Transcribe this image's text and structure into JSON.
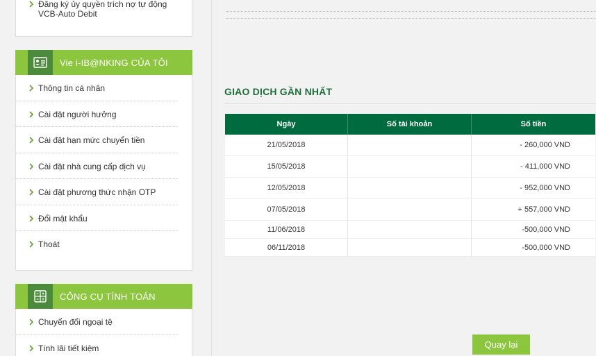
{
  "sidebar": {
    "top_item": {
      "label": "Đăng ký ủy quyền trích nợ tự động VCB-Auto Debit"
    },
    "mine": {
      "title": "Vie i-IB@NKING CỦA TÔI",
      "icon": "user-card-icon",
      "items": [
        {
          "label": "Thông tin cá nhân"
        },
        {
          "label": "Cài đặt người hưởng"
        },
        {
          "label": "Cài đặt hạn mức chuyển tiền"
        },
        {
          "label": "Cài đặt nhà cung cấp dịch vụ"
        },
        {
          "label": "Cài đặt phương thức nhận OTP"
        },
        {
          "label": "Đổi mật khẩu"
        },
        {
          "label": "Thoát"
        }
      ]
    },
    "tools": {
      "title": "CÔNG CỤ TÍNH TOÁN",
      "icon": "calculator-icon",
      "items": [
        {
          "label": "Chuyển đổi ngoại tệ"
        },
        {
          "label": "Tính lãi tiết kiệm"
        }
      ]
    }
  },
  "main": {
    "section_title": "GIAO DỊCH GẦN NHẤT",
    "table": {
      "headers": [
        "Ngày",
        "Số tài khoản",
        "Số tiền"
      ],
      "rows": [
        {
          "date": "21/05/2018",
          "account": "",
          "amount": "- 260,000 VND"
        },
        {
          "date": "15/05/2018",
          "account": "",
          "amount": "- 411,000 VND"
        },
        {
          "date": "12/05/2018",
          "account": "",
          "amount": "- 952,000 VND"
        },
        {
          "date": "07/05/2018",
          "account": "",
          "amount": "+ 557,000 VND"
        },
        {
          "date": "11/06/2018",
          "account": "",
          "amount": "-500,000 VND"
        },
        {
          "date": "06/11/2018",
          "account": "",
          "amount": "-500,000 VND"
        }
      ]
    },
    "back_button": "Quay lại"
  },
  "colors": {
    "green": "#8cc63f",
    "dark_green": "#006b3f",
    "title_green": "#1e6e3c"
  }
}
